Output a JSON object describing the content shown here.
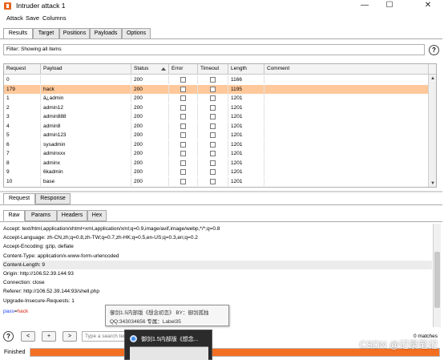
{
  "window": {
    "title": "Intruder attack 1",
    "minimize": "—",
    "maximize": "☐",
    "close": "✕"
  },
  "menu": [
    "Attack",
    "Save",
    "Columns"
  ],
  "main_tabs": [
    "Results",
    "Target",
    "Positions",
    "Payloads",
    "Options"
  ],
  "active_main_tab": "Results",
  "filter": {
    "text": "Filter:  Showing all items"
  },
  "help_glyph": "?",
  "table": {
    "columns": [
      "Request",
      "Payload",
      "Status",
      "Error",
      "Timeout",
      "Length",
      "Comment"
    ],
    "sorted_column": "Status",
    "rows": [
      {
        "request": "0",
        "payload": "",
        "status": "200",
        "length": "1166",
        "highlight": false
      },
      {
        "request": "179",
        "payload": "hack",
        "status": "200",
        "length": "1195",
        "highlight": true
      },
      {
        "request": "1",
        "payload": "ä¿admin",
        "status": "200",
        "length": "1201",
        "highlight": false
      },
      {
        "request": "2",
        "payload": "admin12",
        "status": "200",
        "length": "1201",
        "highlight": false
      },
      {
        "request": "3",
        "payload": "admin888",
        "status": "200",
        "length": "1201",
        "highlight": false
      },
      {
        "request": "4",
        "payload": "admin8",
        "status": "200",
        "length": "1201",
        "highlight": false
      },
      {
        "request": "5",
        "payload": "admin123",
        "status": "200",
        "length": "1201",
        "highlight": false
      },
      {
        "request": "6",
        "payload": "sysadmin",
        "status": "200",
        "length": "1201",
        "highlight": false
      },
      {
        "request": "7",
        "payload": "adminxxx",
        "status": "200",
        "length": "1201",
        "highlight": false
      },
      {
        "request": "8",
        "payload": "adminx",
        "status": "200",
        "length": "1201",
        "highlight": false
      },
      {
        "request": "9",
        "payload": "6kadmin",
        "status": "200",
        "length": "1201",
        "highlight": false
      },
      {
        "request": "10",
        "payload": "base",
        "status": "200",
        "length": "1201",
        "highlight": false
      }
    ]
  },
  "detail_tabs": [
    "Request",
    "Response"
  ],
  "active_detail_tab": "Request",
  "view_tabs": [
    "Raw",
    "Params",
    "Headers",
    "Hex"
  ],
  "active_view_tab": "Raw",
  "request_lines": [
    {
      "text": "Accept: text/html,application/xhtml+xml,application/xml;q=0.9,image/avif,image/webp,*/*;q=0.8",
      "shaded": false
    },
    {
      "text": "Accept-Language: zh-CN,zh;q=0.8,zh-TW;q=0.7,zh-HK;q=0.5,en-US;q=0.3,en;q=0.2",
      "shaded": false
    },
    {
      "text": "Accept-Encoding: gzip, deflate",
      "shaded": false
    },
    {
      "text": "Content-Type: application/x-www-form-urlencoded",
      "shaded": false
    },
    {
      "text": "Content-Length: 9",
      "shaded": true
    },
    {
      "text": "Origin: http://106.52.39.144:93",
      "shaded": false
    },
    {
      "text": "Connection: close",
      "shaded": false
    },
    {
      "text": "Referer: http://106.52.39.144:93/shell.php",
      "shaded": false
    },
    {
      "text": "Upgrade-Insecure-Requests: 1",
      "shaded": false
    },
    {
      "text": "",
      "shaded": false
    }
  ],
  "body_param": {
    "name": "pass",
    "equals": "=",
    "value": "hack"
  },
  "tooltip": {
    "line1": "御剑1.5内部版《想念初恋》 BY：御剑孤独",
    "line2": "QQ:343034656    专属：Label35"
  },
  "search": {
    "help": "?",
    "prev": "<",
    "add": "+",
    "next": ">",
    "placeholder": "Type a search term",
    "matches": "0 matches"
  },
  "status": {
    "text": "Finished",
    "progress": 1.0
  },
  "taskbar_preview": {
    "title": "御剑1.5内部版《想念..."
  },
  "watermark": "CSDN @记录笔记",
  "colors": {
    "accent_orange": "#f36f22",
    "highlight_row": "#ffc89a",
    "param_name": "#1f3fff",
    "param_value": "#d8261c"
  }
}
